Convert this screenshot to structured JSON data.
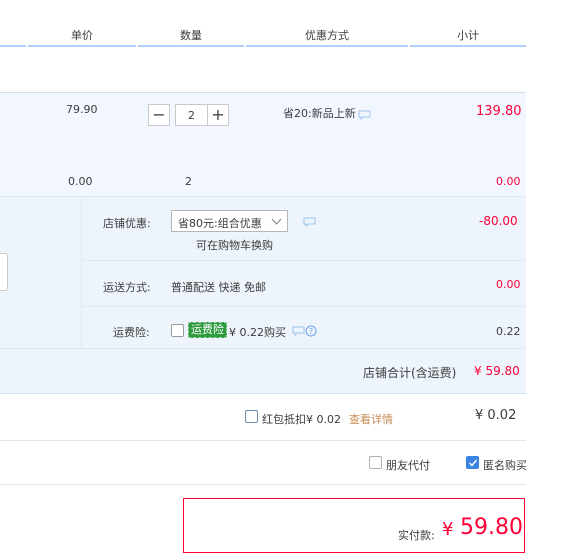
{
  "columns": {
    "unit_price": "单价",
    "quantity": "数量",
    "discount": "优惠方式",
    "subtotal": "小计"
  },
  "item": {
    "unit_price": "79.90",
    "quantity": "2",
    "promo": "省20:新品上新",
    "subtotal": "139.80"
  },
  "gift_row": {
    "unit_price": "0.00",
    "quantity": "2",
    "subtotal": "0.00"
  },
  "store_discount": {
    "label": "店铺优惠:",
    "selected": "省80元:组合优惠",
    "note": "可在购物车换购",
    "amount": "-80.00"
  },
  "shipping": {
    "label": "运送方式:",
    "value": "普通配送 快递 免邮",
    "amount": "0.00"
  },
  "insurance": {
    "label": "运费险:",
    "tag": "运费险",
    "text": "¥ 0.22购买",
    "amount": "0.22"
  },
  "store_total": {
    "label": "店铺合计(含运费)",
    "amount": "¥ 59.80"
  },
  "red_packet": {
    "label": "红包抵扣¥ 0.02",
    "link": "查看详情",
    "amount": "¥ 0.02"
  },
  "options": {
    "friend_pay": "朋友代付",
    "anonymous": "匿名购买"
  },
  "payment": {
    "label": "实付款:",
    "currency": "¥",
    "amount": "59.80"
  },
  "colors": {
    "price_red": "#ff0036",
    "accent_blue": "#3a84e4",
    "panel_bg": "#f2f7ff",
    "insurance_green": "#2e9a3f"
  }
}
